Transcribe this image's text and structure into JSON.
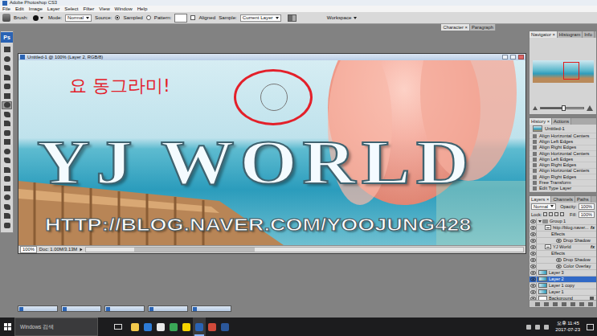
{
  "app": {
    "title": "Adobe Photoshop CS3",
    "logo": "Ps"
  },
  "menu": [
    "File",
    "Edit",
    "Image",
    "Layer",
    "Select",
    "Filter",
    "View",
    "Window",
    "Help"
  ],
  "options": [
    {
      "kind": "label",
      "label": "Brush:"
    },
    {
      "kind": "brush"
    },
    {
      "kind": "select",
      "label": "Mode:",
      "value": "Normal"
    },
    {
      "kind": "label",
      "label": "Source:"
    },
    {
      "kind": "radio",
      "label": "Sampled",
      "selected": true
    },
    {
      "kind": "radio",
      "label": "Pattern:",
      "selected": false
    },
    {
      "kind": "pattern"
    },
    {
      "kind": "checkbox",
      "label": "Aligned",
      "checked": false
    },
    {
      "kind": "select",
      "label": "Sample:",
      "value": "Current Layer"
    }
  ],
  "workspace": {
    "label": "Workspace"
  },
  "docked_tabs": [
    {
      "label": "Character ×",
      "selected": true
    },
    {
      "label": "Paragraph",
      "selected": false
    }
  ],
  "tools": [
    {
      "selected": false
    },
    {
      "selected": false
    },
    {
      "selected": false
    },
    {
      "selected": false
    },
    {
      "selected": false
    },
    {
      "selected": false
    },
    {
      "selected": true
    },
    {
      "selected": false
    },
    {
      "selected": false
    },
    {
      "selected": false
    },
    {
      "selected": false
    },
    {
      "selected": false
    },
    {
      "selected": false
    },
    {
      "selected": false
    },
    {
      "selected": false
    },
    {
      "selected": false
    },
    {
      "selected": false
    },
    {
      "selected": false
    },
    {
      "selected": false
    },
    {
      "selected": false
    }
  ],
  "document": {
    "title": "Untitled-1 @ 100% (Layer 2, RGB/8)",
    "zoom": "100%",
    "doc_info": "Doc: 1.00M/3.13M",
    "canvas": {
      "heading": "YJ WORLD",
      "url": "HTTP://BLOG.NAVER.COM/YOOJUNG428",
      "annotation": "요 동그라미!"
    }
  },
  "navigator": {
    "tabs": [
      {
        "label": "Navigator ×",
        "selected": true
      },
      {
        "label": "Histogram",
        "selected": false
      },
      {
        "label": "Info",
        "selected": false
      }
    ],
    "level": 0.55
  },
  "history": {
    "tabs": [
      {
        "label": "History ×",
        "selected": true
      },
      {
        "label": "Actions",
        "selected": false
      }
    ],
    "snapshot": "Untitled-1",
    "items": [
      {
        "label": "Align Horizontal Centers",
        "selected": false
      },
      {
        "label": "Align Left Edges",
        "selected": false
      },
      {
        "label": "Align Right Edges",
        "selected": false
      },
      {
        "label": "Align Horizontal Centers",
        "selected": false
      },
      {
        "label": "Align Left Edges",
        "selected": false
      },
      {
        "label": "Align Right Edges",
        "selected": false
      },
      {
        "label": "Align Horizontal Centers",
        "selected": false
      },
      {
        "label": "Align Right Edges",
        "selected": false
      },
      {
        "label": "Free Transform",
        "selected": false
      },
      {
        "label": "Edit Type Layer",
        "selected": false
      }
    ]
  },
  "layers": {
    "tabs": [
      {
        "label": "Layers ×",
        "selected": true
      },
      {
        "label": "Channels",
        "selected": false
      },
      {
        "label": "Paths",
        "selected": false
      }
    ],
    "blend": "Normal",
    "opacity_label": "Opacity:",
    "opacity": "100%",
    "lock_label": "Lock:",
    "fill_label": "Fill:",
    "fill": "100%",
    "rows": [
      {
        "kind": "group",
        "name": "Group 1",
        "visible": true,
        "selected": false,
        "expanded": true
      },
      {
        "kind": "text",
        "name": "http://blog.naver...",
        "visible": true,
        "selected": false,
        "badge": "fx"
      },
      {
        "kind": "effects",
        "name": "Effects",
        "visible": true,
        "selected": false
      },
      {
        "kind": "effect",
        "name": "Drop Shadow",
        "visible": true,
        "selected": false
      },
      {
        "kind": "text",
        "name": "YJ World",
        "visible": true,
        "selected": false,
        "badge": "fx"
      },
      {
        "kind": "effects",
        "name": "Effects",
        "visible": true,
        "selected": false
      },
      {
        "kind": "effect",
        "name": "Drop Shadow",
        "visible": true,
        "selected": false
      },
      {
        "kind": "effect",
        "name": "Color Overlay",
        "visible": true,
        "selected": false
      },
      {
        "kind": "layer",
        "name": "Layer 3",
        "visible": true,
        "selected": false
      },
      {
        "kind": "layer",
        "name": "Layer 2",
        "visible": true,
        "selected": true
      },
      {
        "kind": "layer",
        "name": "Layer 1 copy",
        "visible": true,
        "selected": false
      },
      {
        "kind": "layer",
        "name": "Layer 1",
        "visible": true,
        "selected": false
      },
      {
        "kind": "background",
        "name": "Background",
        "visible": true,
        "selected": false
      }
    ]
  },
  "taskbar": {
    "search": "Windows 검색",
    "apps": [
      {
        "color": "#f2c94c",
        "selected": false
      },
      {
        "color": "#2d7bd6",
        "selected": false
      },
      {
        "color": "#e9e9e9",
        "selected": false
      },
      {
        "color": "#3aa757",
        "selected": false
      },
      {
        "color": "#f5d400",
        "selected": false
      },
      {
        "color": "#2a63b4",
        "selected": true
      },
      {
        "color": "#d04a3a",
        "selected": false
      },
      {
        "color": "#2b579a",
        "selected": false
      }
    ],
    "time": "오후 11:45",
    "date": "2017-07-23"
  }
}
